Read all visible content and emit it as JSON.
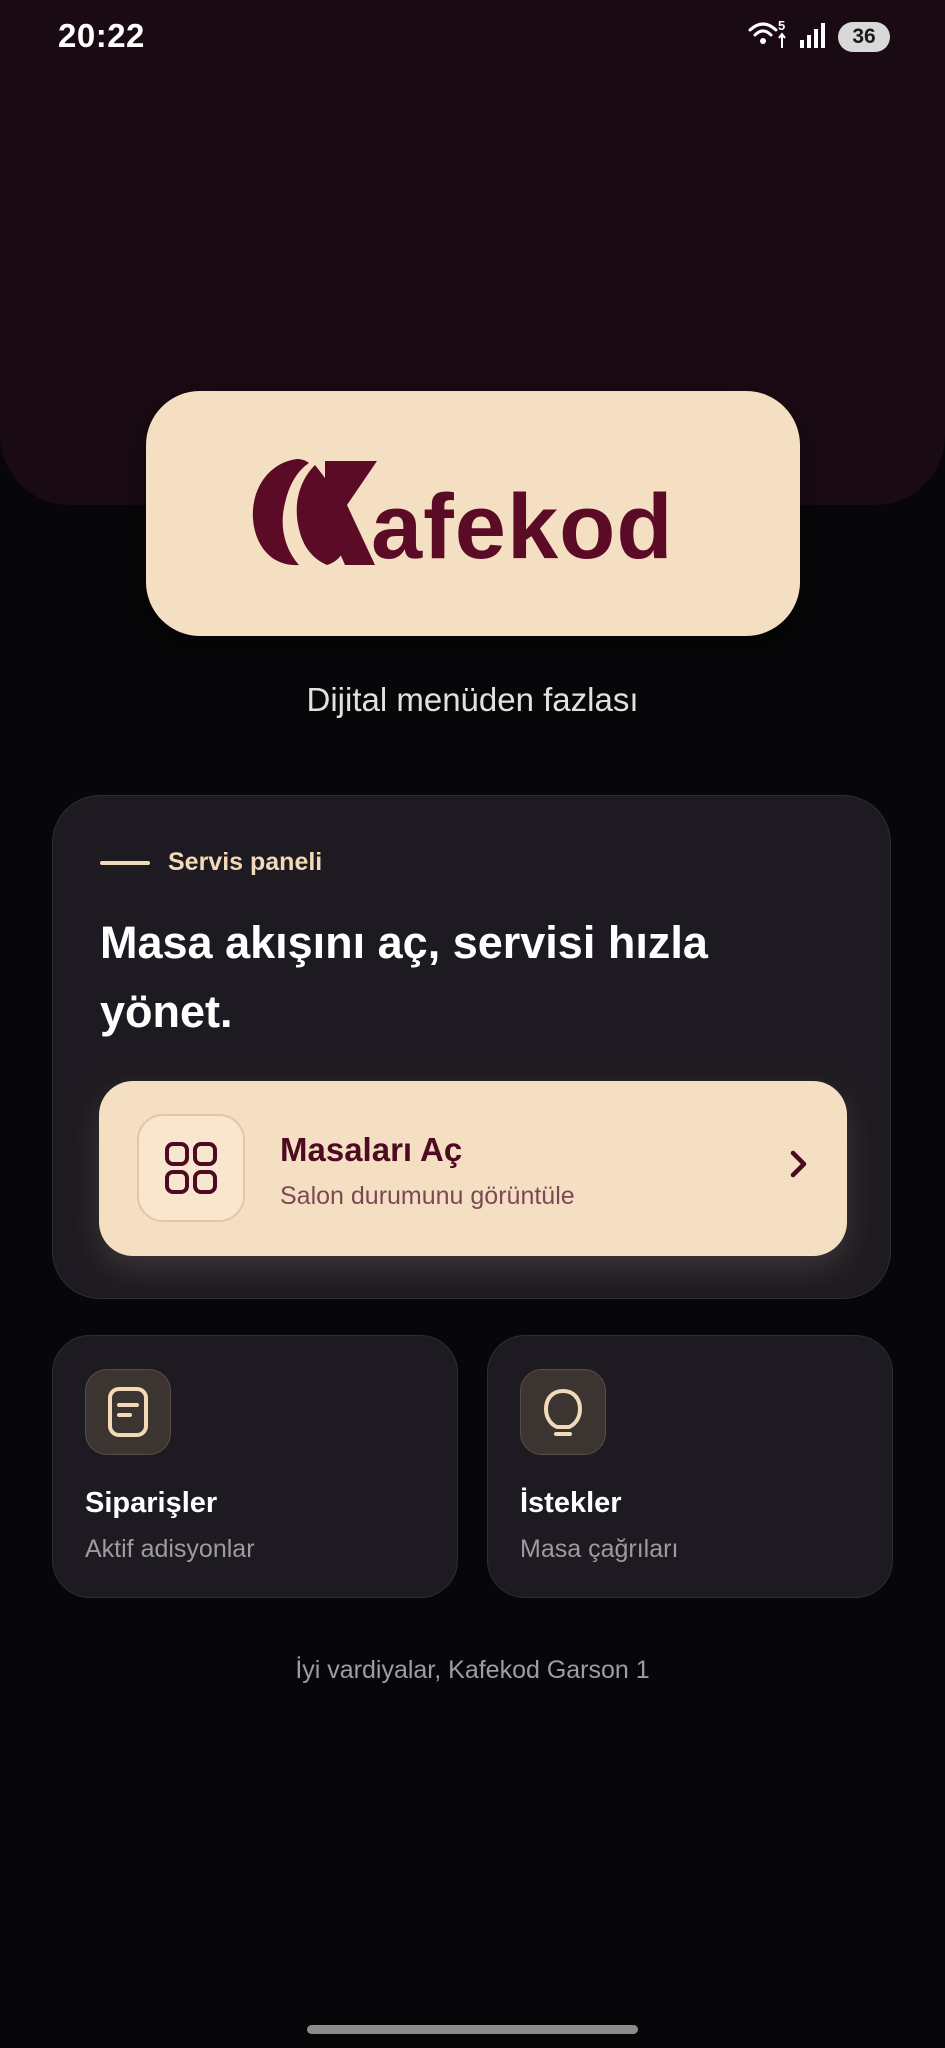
{
  "status_bar": {
    "time": "20:22",
    "battery": "36",
    "wifi_label": "5",
    "icons": [
      "wifi-icon",
      "signal-icon",
      "battery-icon"
    ]
  },
  "brand": {
    "name": "Kafekod",
    "logo_lettering": "afekod",
    "tagline": "Dijital menüden fazlası",
    "colors": {
      "primary": "#5c0b26",
      "cream": "#f5dfc2",
      "hero_bg": "#1a0a13",
      "page_bg": "#070709",
      "card_bg": "#1d1b21"
    }
  },
  "service_panel": {
    "eyebrow": "Servis paneli",
    "headline": "Masa akışını aç, servisi hızla yönet.",
    "cta": {
      "title": "Masaları Aç",
      "subtitle": "Salon durumunu görüntüle",
      "icon": "grid-icon",
      "chevron": "chevron-right-icon"
    }
  },
  "tiles": [
    {
      "title": "Siparişler",
      "subtitle": "Aktif adisyonlar",
      "icon": "receipt-icon"
    },
    {
      "title": "İstekler",
      "subtitle": "Masa çağrıları",
      "icon": "bell-icon"
    }
  ],
  "footer": {
    "greeting": "İyi vardiyalar, Kafekod Garson 1"
  }
}
